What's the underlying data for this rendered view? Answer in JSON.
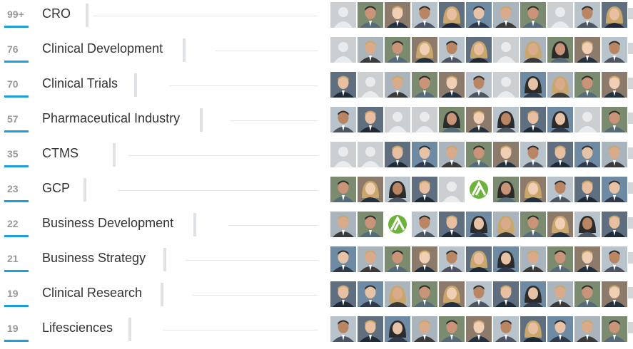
{
  "skills": [
    {
      "count": "99+",
      "name": "CRO",
      "avatars": [
        "p",
        "m",
        "m",
        "m",
        "f",
        "m",
        "m",
        "m",
        "p",
        "m",
        "f"
      ]
    },
    {
      "count": "76",
      "name": "Clinical Development",
      "avatars": [
        "p",
        "m",
        "m",
        "f",
        "m",
        "f",
        "p",
        "f",
        "f",
        "m",
        "m"
      ]
    },
    {
      "count": "70",
      "name": "Clinical Trials",
      "avatars": [
        "m",
        "p",
        "m",
        "m",
        "m",
        "m",
        "p",
        "f",
        "f",
        "m",
        "m"
      ]
    },
    {
      "count": "57",
      "name": "Pharmaceutical Industry",
      "avatars": [
        "m",
        "m",
        "p",
        "p",
        "f",
        "m",
        "f",
        "m",
        "f",
        "p",
        "m"
      ]
    },
    {
      "count": "35",
      "name": "CTMS",
      "avatars": [
        "p",
        "p",
        "m",
        "m",
        "m",
        "m",
        "m",
        "m",
        "m",
        "m",
        "m"
      ]
    },
    {
      "count": "23",
      "name": "GCP",
      "avatars": [
        "m",
        "f",
        "f",
        "m",
        "p",
        "logo",
        "f",
        "f",
        "m",
        "m",
        "m"
      ]
    },
    {
      "count": "22",
      "name": "Business Development",
      "avatars": [
        "m",
        "m",
        "logo",
        "m",
        "m",
        "f",
        "f",
        "m",
        "f",
        "f",
        "m"
      ]
    },
    {
      "count": "21",
      "name": "Business Strategy",
      "avatars": [
        "m",
        "m",
        "m",
        "m",
        "m",
        "f",
        "f",
        "m",
        "m",
        "m",
        "m"
      ]
    },
    {
      "count": "19",
      "name": "Clinical Research",
      "avatars": [
        "m",
        "m",
        "f",
        "m",
        "f",
        "m",
        "m",
        "f",
        "m",
        "m",
        "m"
      ]
    },
    {
      "count": "19",
      "name": "Lifesciences",
      "avatars": [
        "m",
        "m",
        "f",
        "m",
        "m",
        "m",
        "m",
        "f",
        "m",
        "m",
        "m"
      ]
    }
  ],
  "colors": {
    "accent": "#1e9fd9",
    "count_text": "#999999",
    "name_text": "#333333",
    "divider": "#dfe2e4"
  },
  "icons": {
    "placeholder": "person-placeholder-icon",
    "logo": "company-logo-icon"
  }
}
